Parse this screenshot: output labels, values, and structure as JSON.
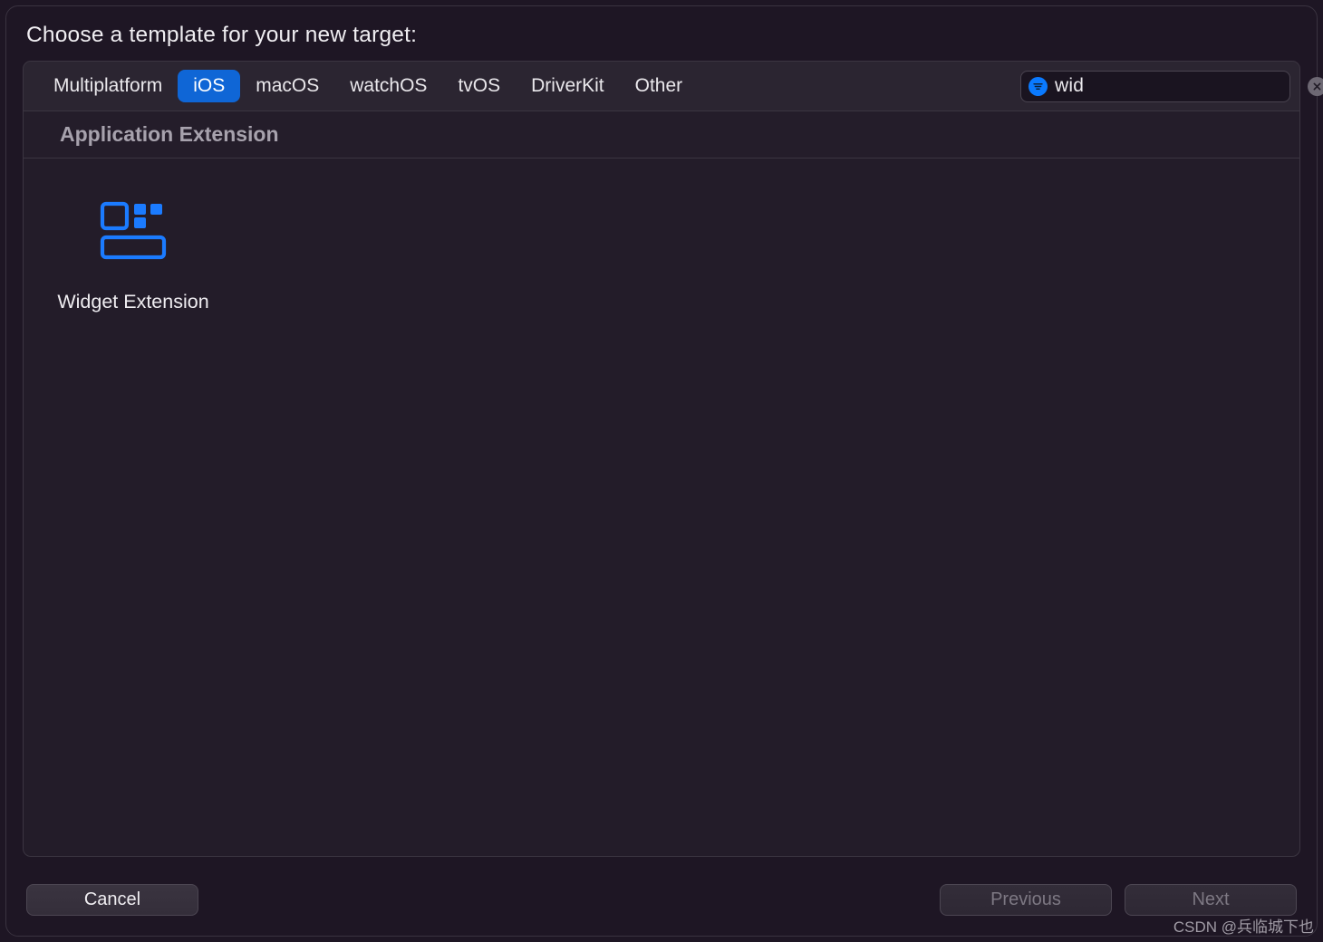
{
  "header": {
    "title": "Choose a template for your new target:"
  },
  "tabs": {
    "items": [
      {
        "label": "Multiplatform",
        "selected": false
      },
      {
        "label": "iOS",
        "selected": true
      },
      {
        "label": "macOS",
        "selected": false
      },
      {
        "label": "watchOS",
        "selected": false
      },
      {
        "label": "tvOS",
        "selected": false
      },
      {
        "label": "DriverKit",
        "selected": false
      },
      {
        "label": "Other",
        "selected": false
      }
    ]
  },
  "search": {
    "value": "wid",
    "filter_icon": "filter-lines-icon",
    "clear_icon": "clear-x-icon"
  },
  "section": {
    "heading": "Application Extension"
  },
  "templates": [
    {
      "label": "Widget Extension",
      "icon": "widget-extension-icon"
    }
  ],
  "footer": {
    "cancel": "Cancel",
    "previous": "Previous",
    "next": "Next",
    "previous_enabled": false,
    "next_enabled": false
  },
  "watermark": "CSDN @兵临城下也",
  "colors": {
    "accent": "#0f66d6",
    "icon_blue": "#1b7bff"
  }
}
